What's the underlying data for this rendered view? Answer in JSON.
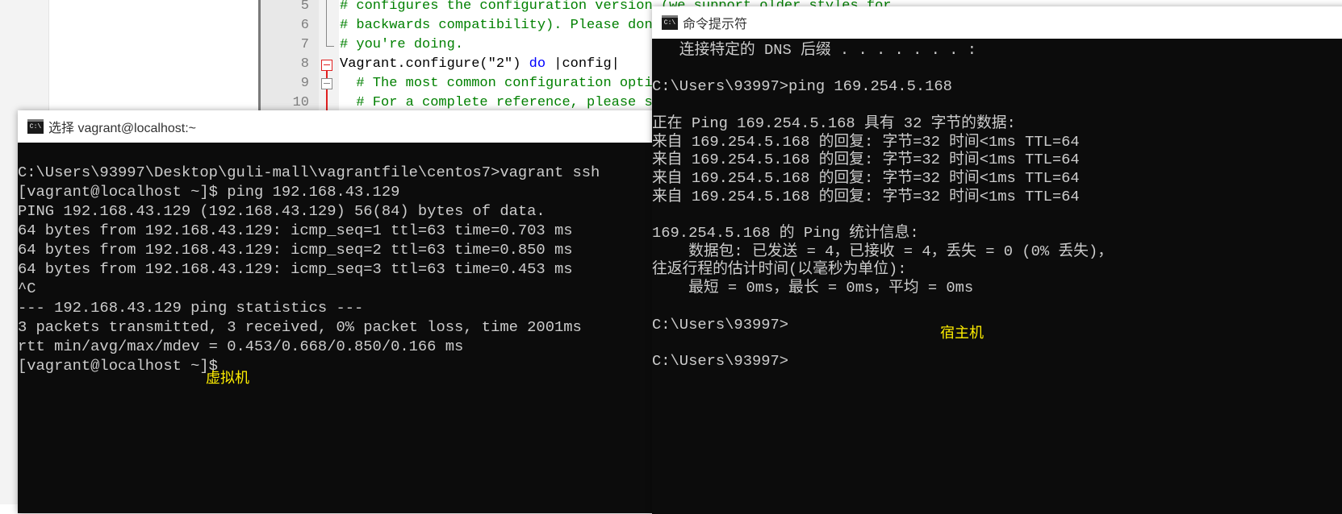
{
  "editor": {
    "lines": [
      {
        "num": "5",
        "text": "# configures the configuration version (we support older styles for"
      },
      {
        "num": "6",
        "text": "# backwards compatibility). Please don't change it unless you know what"
      },
      {
        "num": "7",
        "text": "# you're doing."
      },
      {
        "num": "8",
        "pre": "Vagrant.configure(\"2\") ",
        "kw": "do",
        "post": " |config|"
      },
      {
        "num": "9",
        "text": "  # The most common configuration options are documented and commented below."
      },
      {
        "num": "10",
        "text": "  # For a complete reference, please see the online documentation at"
      }
    ]
  },
  "vm_terminal": {
    "title": "选择 vagrant@localhost:~",
    "icon": "cmd-icon",
    "lines": [
      "",
      "C:\\Users\\93997\\Desktop\\guli-mall\\vagrantfile\\centos7>vagrant ssh",
      "[vagrant@localhost ~]$ ping 192.168.43.129",
      "PING 192.168.43.129 (192.168.43.129) 56(84) bytes of data.",
      "64 bytes from 192.168.43.129: icmp_seq=1 ttl=63 time=0.703 ms",
      "64 bytes from 192.168.43.129: icmp_seq=2 ttl=63 time=0.850 ms",
      "64 bytes from 192.168.43.129: icmp_seq=3 ttl=63 time=0.453 ms",
      "^C",
      "--- 192.168.43.129 ping statistics ---",
      "3 packets transmitted, 3 received, 0% packet loss, time 2001ms",
      "rtt min/avg/max/mdev = 0.453/0.668/0.850/0.166 ms",
      "[vagrant@localhost ~]$"
    ],
    "annotation": "虚拟机"
  },
  "host_terminal": {
    "title": "命令提示符",
    "icon": "cmd-icon",
    "lines": [
      "   连接特定的 DNS 后缀 . . . . . . . :",
      "",
      "C:\\Users\\93997>ping 169.254.5.168",
      "",
      "正在 Ping 169.254.5.168 具有 32 字节的数据:",
      "来自 169.254.5.168 的回复: 字节=32 时间<1ms TTL=64",
      "来自 169.254.5.168 的回复: 字节=32 时间<1ms TTL=64",
      "来自 169.254.5.168 的回复: 字节=32 时间<1ms TTL=64",
      "来自 169.254.5.168 的回复: 字节=32 时间<1ms TTL=64",
      "",
      "169.254.5.168 的 Ping 统计信息:",
      "    数据包: 已发送 = 4，已接收 = 4，丢失 = 0 (0% 丢失)，",
      "往返行程的估计时间(以毫秒为单位):",
      "    最短 = 0ms，最长 = 0ms，平均 = 0ms",
      "",
      "C:\\Users\\93997>",
      "",
      "C:\\Users\\93997>"
    ],
    "annotation": "宿主机"
  },
  "colors": {
    "terminal_bg": "#0c0c0c",
    "terminal_text": "#cccccc",
    "annotation": "#ffee00",
    "comment": "#008000",
    "keyword": "#0000ff",
    "fold_marker": "#e02020"
  }
}
